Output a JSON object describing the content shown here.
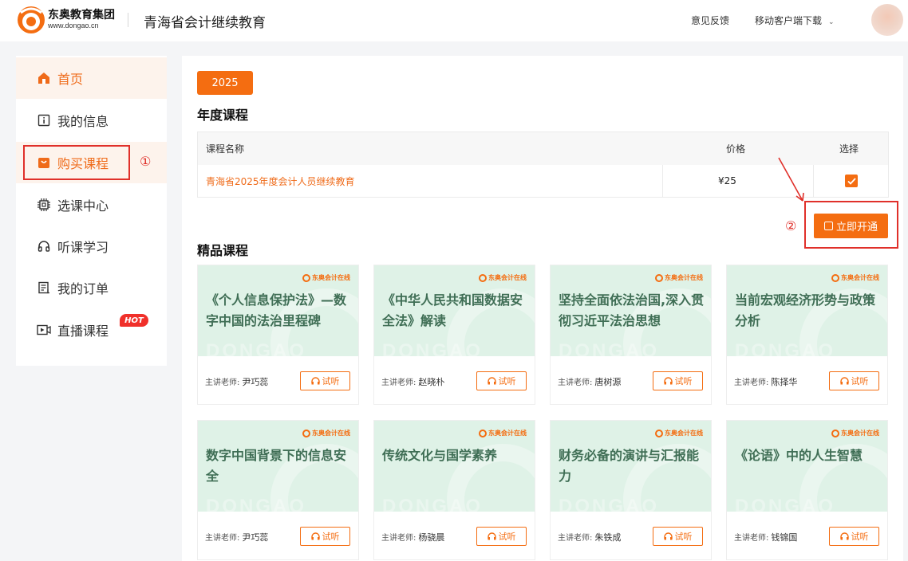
{
  "header": {
    "logo_line1": "东奥教育集团",
    "logo_line2": "www.dongao.cn",
    "site_title": "青海省会计继续教育",
    "feedback": "意见反馈",
    "mobile_download": "移动客户端下载"
  },
  "sidebar": {
    "items": [
      {
        "label": "首页",
        "icon": "home-icon"
      },
      {
        "label": "我的信息",
        "icon": "info-icon"
      },
      {
        "label": "购买课程",
        "icon": "bag-icon"
      },
      {
        "label": "选课中心",
        "icon": "chip-icon"
      },
      {
        "label": "听课学习",
        "icon": "headphones-icon"
      },
      {
        "label": "我的订单",
        "icon": "order-icon"
      },
      {
        "label": "直播课程",
        "icon": "live-icon"
      }
    ],
    "hot_badge": "HOT",
    "annotation_1": "①"
  },
  "main": {
    "year_tab": "2025",
    "annual_title": "年度课程",
    "table": {
      "headers": [
        "课程名称",
        "价格",
        "选择"
      ],
      "rows": [
        {
          "name": "青海省2025年度会计人员继续教育",
          "price": "¥25",
          "selected": true
        }
      ]
    },
    "annotation_2": "②",
    "open_button": "立即开通",
    "featured_title": "精品课程",
    "brand_label": "东奥会计在线",
    "teacher_prefix": "主讲老师:",
    "try_label": "试听",
    "courses": [
      {
        "title": "《个人信息保护法》—数字中国的法治里程碑",
        "teacher": "尹巧蕊"
      },
      {
        "title": "《中华人民共和国数据安全法》解读",
        "teacher": "赵晓朴"
      },
      {
        "title": "坚持全面依法治国,深入贯彻习近平法治思想",
        "teacher": "唐树源"
      },
      {
        "title": "当前宏观经济形势与政策分析",
        "teacher": "陈择华"
      },
      {
        "title": "数字中国背景下的信息安全",
        "teacher": "尹巧蕊"
      },
      {
        "title": "传统文化与国学素养",
        "teacher": "杨骁晨"
      },
      {
        "title": "财务必备的演讲与汇报能力",
        "teacher": "朱铁成"
      },
      {
        "title": "《论语》中的人生智慧",
        "teacher": "钱锦国"
      }
    ]
  },
  "colors": {
    "accent": "#f46d11",
    "annotation_red": "#e0302a",
    "card_bg": "#dff2e7",
    "card_title": "#3f6e55"
  }
}
